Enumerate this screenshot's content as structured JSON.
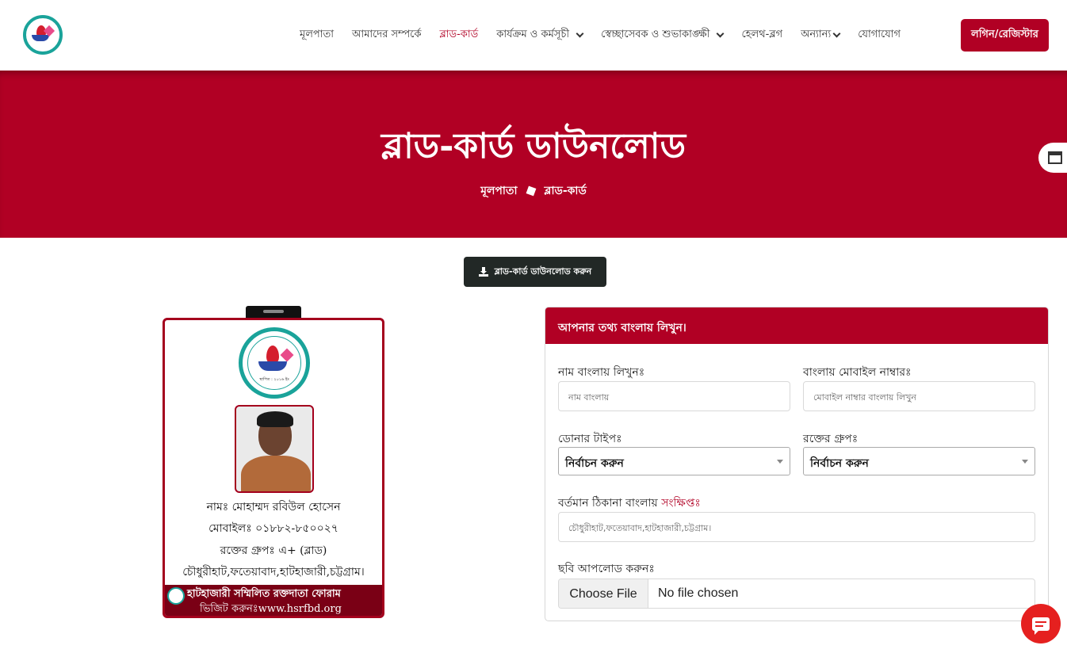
{
  "nav": {
    "items": [
      {
        "label": "মূলপাতা",
        "dropdown": false,
        "active": false
      },
      {
        "label": "আমাদের সম্পর্কে",
        "dropdown": false,
        "active": false
      },
      {
        "label": "ব্লাড-কার্ড",
        "dropdown": false,
        "active": true
      },
      {
        "label": "কার্যক্রম ও কর্মসূচী",
        "dropdown": true,
        "active": false
      },
      {
        "label": "স্বেচ্ছাসেবক ও শুভাকাঙ্ক্ষী",
        "dropdown": true,
        "active": false
      },
      {
        "label": "হেলথ-ব্লগ",
        "dropdown": false,
        "active": false
      },
      {
        "label": "অন্যান্য",
        "dropdown": true,
        "active": false
      },
      {
        "label": "যোগাযোগ",
        "dropdown": false,
        "active": false
      }
    ],
    "login_label": "লগিন/রেজিস্টার",
    "accent": "#b10024"
  },
  "hero": {
    "title": "ব্লাড-কার্ড ডাউনলোড",
    "breadcrumb_home": "মূলপাতা",
    "breadcrumb_current": "ব্লাড-কার্ড"
  },
  "download_button": {
    "label": "ব্লাড-কার্ড ডাউনলোড করুন",
    "icon": "download-icon"
  },
  "card": {
    "logo_established": "স্থাপিত : ২০১৬ ইং",
    "name_line": "নামঃ মোহাম্মদ রবিউল হোসেন",
    "mobile_line": "মোবাইলঃ ০১৮৮২-৮৫০০২৭",
    "blood_line": "রক্তের গ্রুপঃ এ+ (ব্লাড)",
    "address_line": "চৌধুরীহাট,ফতেয়াবাদ,হাটহাজারী,চট্টগ্রাম।",
    "footer_org": "হাটহাজারী সম্মিলিত রক্তদাতা ফোরাম",
    "footer_site": "ভিজিট করুনঃwww.hsrfbd.org"
  },
  "form": {
    "header": "আপনার তথ্য বাংলায় লিখুন।",
    "name_label": "নাম বাংলায় লিখুনঃ",
    "name_placeholder": "নাম বাংলায়",
    "mobile_label": "বাংলায় মোবাইল নাম্বারঃ",
    "mobile_placeholder": "মোবাইল নাম্বার বাংলায় লিখুন",
    "donor_label": "ডোনার টাইপঃ",
    "donor_value": "নির্বাচন করুন",
    "blood_label": "রক্তের গ্রুপঃ",
    "blood_value": "নির্বাচন করুন",
    "address_label": "বর্তমান ঠিকানা বাংলায়",
    "address_label_red": "সংক্ষিপ্তঃ",
    "address_placeholder": "চৌধুরীহাট,ফতেয়াবাদ,হাটহাজারী,চট্টগ্রাম।",
    "photo_label": "ছবি আপলোড করুনঃ",
    "file_button": "Choose File",
    "file_status": "No file chosen"
  },
  "icons": {
    "side_widget": "calculator-icon",
    "chat": "chat-icon"
  }
}
